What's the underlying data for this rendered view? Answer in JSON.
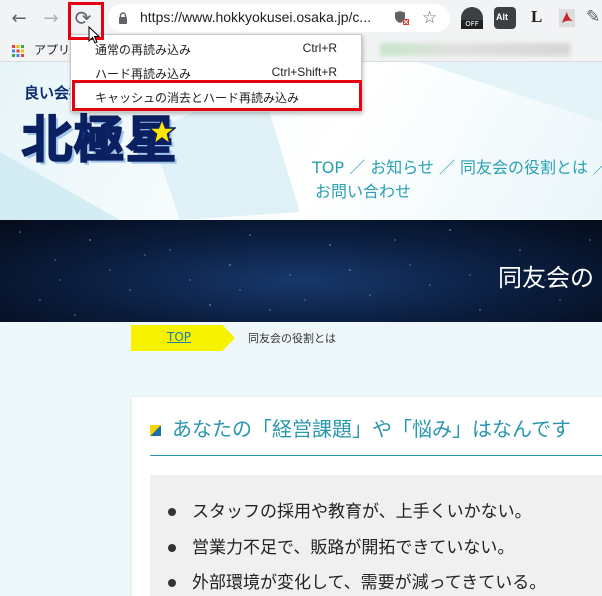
{
  "browser": {
    "back_icon": "←",
    "forward_icon": "→",
    "reload_icon": "⟳",
    "url": "https://www.hokkyokusei.osaka.jp/c...",
    "bookmarks_apps_label": "アプリ",
    "extensions": [
      "off-badge",
      "alt-badge",
      "L",
      "pdf-icon",
      "puzzle-icon"
    ],
    "ext_off_label": "OFF",
    "ext_alt_label": "Alt",
    "ext_l_label": "L"
  },
  "context_menu": {
    "items": [
      {
        "label": "通常の再読み込み",
        "shortcut": "Ctrl+R"
      },
      {
        "label": "ハード再読み込み",
        "shortcut": "Ctrl+Shift+R"
      },
      {
        "label": "キャッシュの消去とハード再読み込み",
        "shortcut": ""
      }
    ]
  },
  "site": {
    "logo_tagline": "良い会社",
    "logo_main": "北極星",
    "nav_line1": "TOP ／ お知らせ ／ 同友会の役割とは ／ 〉",
    "nav_line2": "お問い合わせ",
    "hero_title": "同友会の",
    "breadcrumb_top": "TOP",
    "breadcrumb_current": "同友会の役割とは",
    "section_title": "あなたの「経営課題」や「悩み」はなんです",
    "issues": [
      "スタッフの採用や教育が、上手くいかない。",
      "営業力不足で、販路が開拓できていない。",
      "外部環境が変化して、需要が減ってきている。"
    ]
  },
  "colors": {
    "highlight": "#e60012",
    "accent": "#2a96ae",
    "breadcrumb_bg": "#f7f200",
    "logo_blue": "#0b3a8c"
  }
}
